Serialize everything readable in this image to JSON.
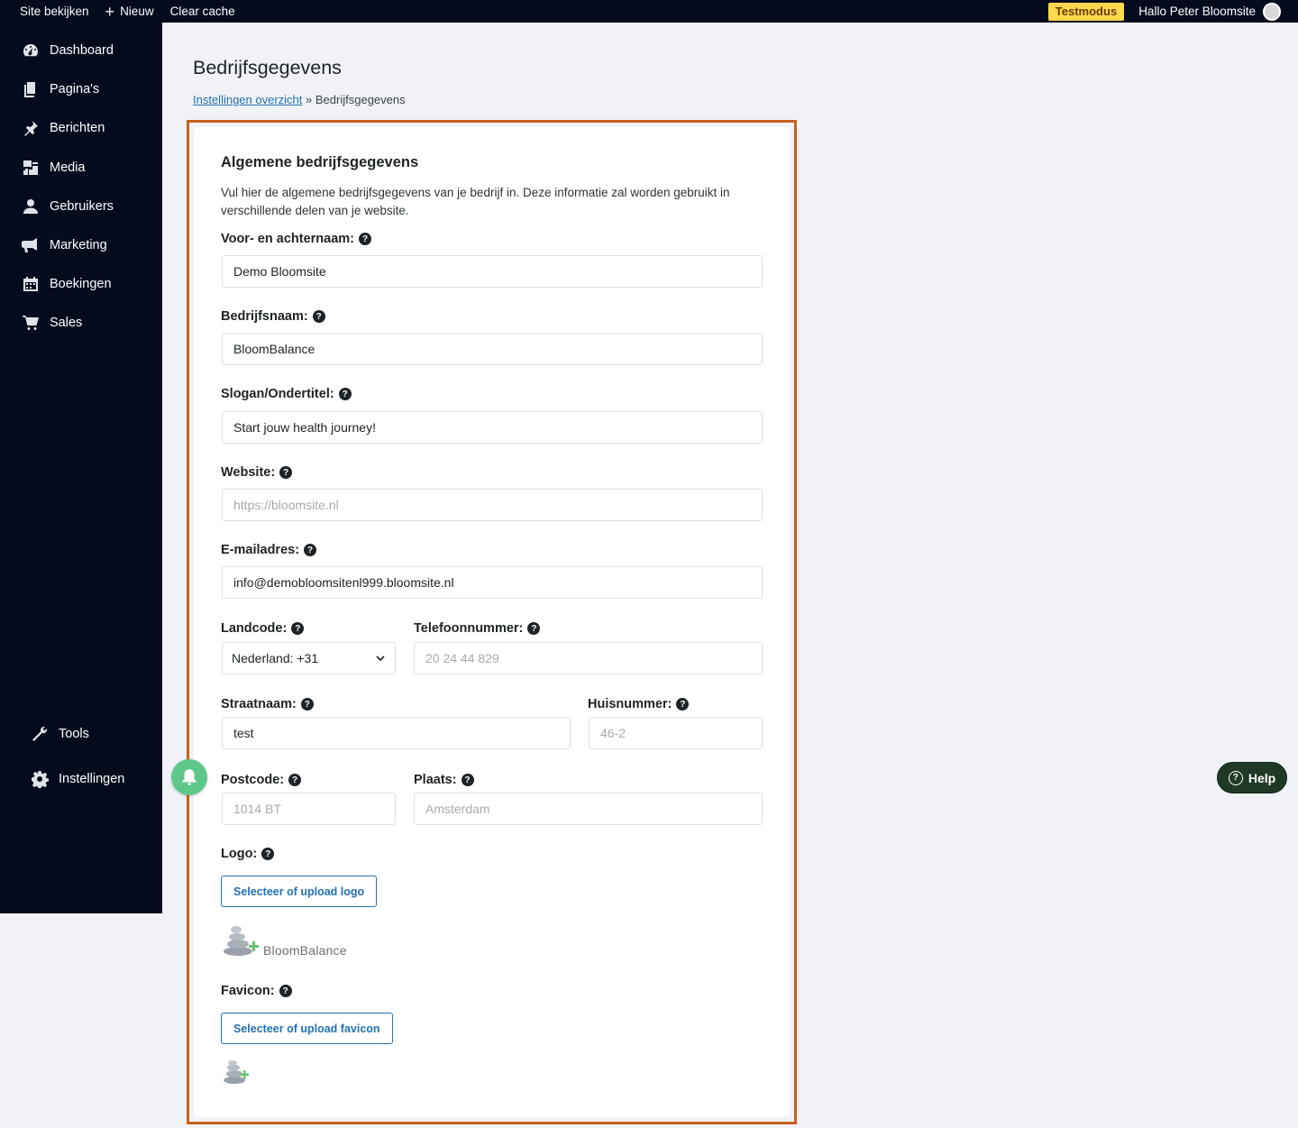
{
  "adminbar": {
    "site_link": "Site bekijken",
    "new_label": "Nieuw",
    "clear_cache": "Clear cache",
    "test_badge": "Testmodus",
    "greeting": "Hallo Peter Bloomsite"
  },
  "sidebar": {
    "items": [
      {
        "label": "Dashboard",
        "icon": "dashboard-icon"
      },
      {
        "label": "Pagina's",
        "icon": "pages-icon"
      },
      {
        "label": "Berichten",
        "icon": "pin-icon"
      },
      {
        "label": "Media",
        "icon": "media-icon"
      },
      {
        "label": "Gebruikers",
        "icon": "user-icon"
      },
      {
        "label": "Marketing",
        "icon": "megaphone-icon"
      },
      {
        "label": "Boekingen",
        "icon": "calendar-icon"
      },
      {
        "label": "Sales",
        "icon": "cart-icon"
      }
    ],
    "bottom": [
      {
        "label": "Tools",
        "icon": "wrench-icon"
      },
      {
        "label": "Instellingen",
        "icon": "gear-icon"
      }
    ]
  },
  "page": {
    "title": "Bedrijfsgegevens",
    "breadcrumb_link": "Instellingen overzicht",
    "breadcrumb_sep": "»",
    "breadcrumb_current": "Bedrijfsgegevens"
  },
  "form": {
    "section_title": "Algemene bedrijfsgegevens",
    "intro": "Vul hier de algemene bedrijfsgegevens van je bedrijf in. Deze informatie zal worden gebruikt in verschillende delen van je website.",
    "name_label": "Voor- en achternaam:",
    "name_value": "Demo Bloomsite",
    "company_label": "Bedrijfsnaam:",
    "company_value": "BloomBalance",
    "slogan_label": "Slogan/Ondertitel:",
    "slogan_value": "Start jouw health journey!",
    "website_label": "Website:",
    "website_placeholder": "https://bloomsite.nl",
    "email_label": "E-mailadres:",
    "email_value": "info@demobloomsitenl999.bloomsite.nl",
    "country_label": "Landcode:",
    "country_value": "Nederland: +31",
    "phone_label": "Telefoonnummer:",
    "phone_placeholder": "20 24 44 829",
    "street_label": "Straatnaam:",
    "street_value": "test",
    "house_label": "Huisnummer:",
    "house_placeholder": "46-2",
    "postcode_label": "Postcode:",
    "postcode_placeholder": "1014 BT",
    "city_label": "Plaats:",
    "city_placeholder": "Amsterdam",
    "logo_label": "Logo:",
    "logo_button": "Selecteer of upload logo",
    "logo_text": "BloomBalance",
    "favicon_label": "Favicon:",
    "favicon_button": "Selecteer of upload favicon"
  },
  "widgets": {
    "help_label": "Help"
  },
  "colors": {
    "adminbar_bg": "#040b1c",
    "accent": "#2271b1",
    "highlight": "#c8601c",
    "test_badge": "#ffd84d",
    "help_bg": "#1e3a26"
  }
}
